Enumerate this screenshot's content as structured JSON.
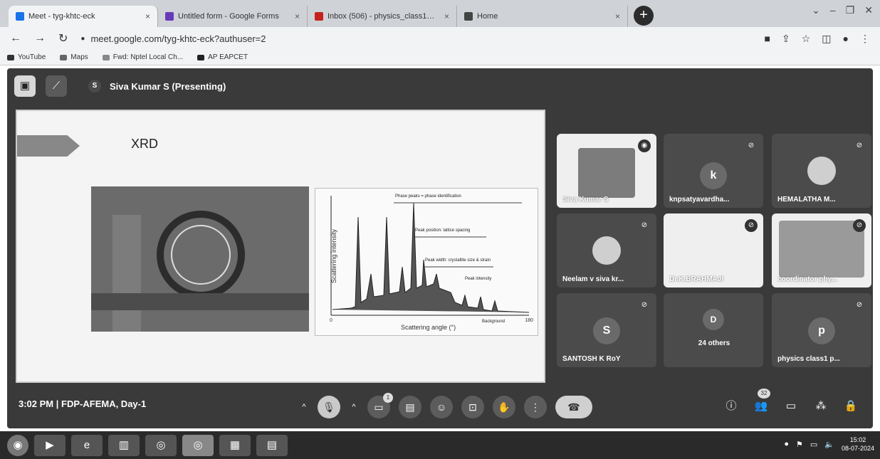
{
  "browser": {
    "tabs": [
      {
        "title": "Meet - tyg-khtc-eck",
        "close": "×",
        "color": "#1a73e8",
        "active": true
      },
      {
        "title": "Untitled form - Google Forms",
        "close": "×",
        "color": "#673ab7",
        "active": false
      },
      {
        "title": "Inbox (506) - physics_class1@an",
        "close": "×",
        "color": "#c5221f",
        "active": false
      },
      {
        "title": "Home",
        "close": "×",
        "color": "#444444",
        "active": false
      }
    ],
    "new_tab": "+",
    "url": "meet.google.com/tyg-khtc-eck?authuser=2",
    "bookmarks": [
      "YouTube",
      "Maps",
      "Fwd: Nptel Local Ch...",
      "AP EAPCET"
    ]
  },
  "meet": {
    "presenter_initial": "S",
    "presenter_label": "Siva Kumar S (Presenting)",
    "slide": {
      "title": "XRD",
      "plot": {
        "ylabel": "Scattering intensity",
        "xlabel": "Scattering angle (°)",
        "x_start": "0",
        "x_end": "180",
        "annotations": [
          "Phase peaks = phase identification",
          "Peak position: lattice spacing",
          "Peak width: crystallite size & strain",
          "Peak intensity",
          "Background"
        ]
      }
    },
    "participants": [
      {
        "name": "Siva Kumar S",
        "type": "camera",
        "speaking": true
      },
      {
        "name": "knpsatyavardha...",
        "type": "initial",
        "initial": "k"
      },
      {
        "name": "HEMALATHA M...",
        "type": "photo"
      },
      {
        "name": "Neelam v siva kr...",
        "type": "photo"
      },
      {
        "name": "Dr.K.BRAHMAJI",
        "type": "light"
      },
      {
        "name": "coordinator phy...",
        "type": "camera"
      },
      {
        "name": "SANTOSH K RoY",
        "type": "initial",
        "initial": "S"
      },
      {
        "name": "24 others",
        "type": "group",
        "initial": "D"
      },
      {
        "name": "physics class1 p...",
        "type": "initial",
        "initial": "p"
      }
    ],
    "time": "3:02 PM",
    "separator": "|",
    "meeting_name": "FDP-AFEMA, Day-1",
    "present_badge": "1",
    "people_count": "32"
  },
  "taskbar": {
    "time": "15:02",
    "date": "08-07-2024"
  },
  "colors": {
    "meet_bg": "#3a3a3a",
    "tile_bg": "#4b4b4b",
    "end_call": "#d0d0d0"
  }
}
